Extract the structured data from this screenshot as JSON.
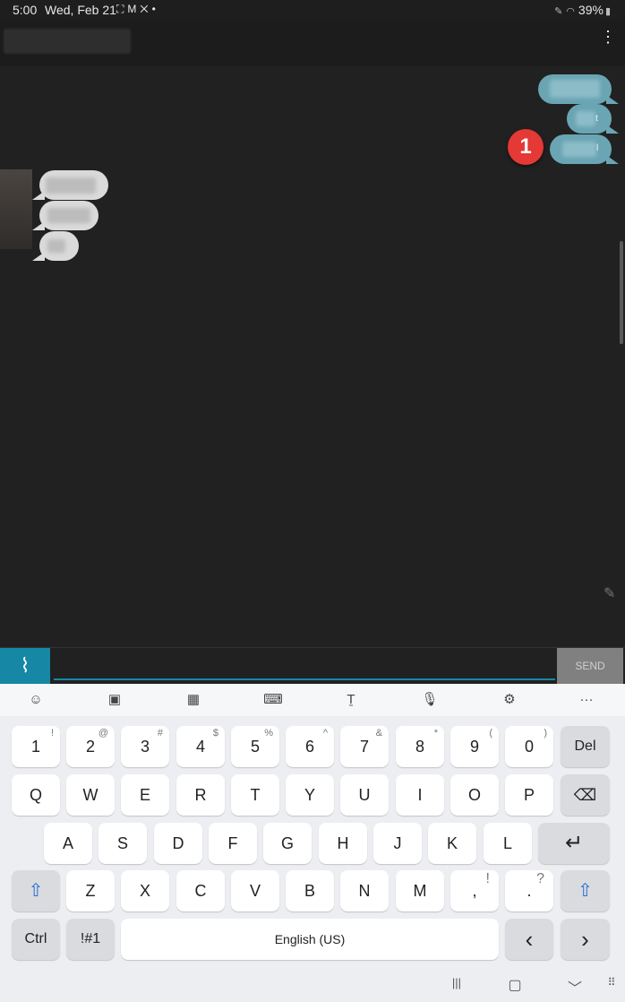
{
  "status_bar": {
    "time": "5:00",
    "date": "Wed, Feb 21",
    "icons": [
      "screenshot-icon",
      "gmail-icon",
      "tools-icon",
      "dot-icon"
    ],
    "battery": "39%",
    "right_icons": [
      "pen-icon",
      "wifi-icon",
      "battery-icon"
    ]
  },
  "toolbar": {
    "menu_glyph": "⋮"
  },
  "conversation": {
    "outgoing": [
      {
        "visible_char": ""
      },
      {
        "visible_char": "t"
      },
      {
        "visible_char": "l"
      }
    ],
    "badge_number": "1"
  },
  "compose": {
    "attach_glyph": "📎",
    "input_value": "",
    "input_placeholder": "",
    "send_label": "SEND"
  },
  "keyboard": {
    "toolbar": [
      "emoji-icon",
      "clipboard-icon",
      "one-handed-icon",
      "keyboard-icon",
      "handwriting-icon",
      "mic-icon",
      "settings-icon",
      "more-icon"
    ],
    "toolbar_glyphs": [
      "☺",
      "▣",
      "▦",
      "⌨",
      "Ṯ",
      "🎙",
      "⚙",
      "···"
    ],
    "row1": [
      {
        "label": "1",
        "sub": "!"
      },
      {
        "label": "2",
        "sub": "@"
      },
      {
        "label": "3",
        "sub": "#"
      },
      {
        "label": "4",
        "sub": "$"
      },
      {
        "label": "5",
        "sub": "%"
      },
      {
        "label": "6",
        "sub": "^"
      },
      {
        "label": "7",
        "sub": "&"
      },
      {
        "label": "8",
        "sub": "*"
      },
      {
        "label": "9",
        "sub": "("
      },
      {
        "label": "0",
        "sub": ")"
      }
    ],
    "del_label": "Del",
    "row2": [
      "Q",
      "W",
      "E",
      "R",
      "T",
      "Y",
      "U",
      "I",
      "O",
      "P"
    ],
    "backspace_glyph": "⌫",
    "row3": [
      "A",
      "S",
      "D",
      "F",
      "G",
      "H",
      "J",
      "K",
      "L"
    ],
    "enter_glyph": "↵",
    "row4": [
      "Z",
      "X",
      "C",
      "V",
      "B",
      "N",
      "M"
    ],
    "comma": {
      "label": ",",
      "sub": "!"
    },
    "period": {
      "label": ".",
      "sub": "?"
    },
    "shift_glyph": "⇧",
    "ctrl_label": "Ctrl",
    "symbols_label": "!#1",
    "space_label": "English (US)",
    "left_arrow": "‹",
    "right_arrow": "›",
    "nav": {
      "recents": "|||",
      "home": "▢",
      "back": "﹀",
      "keyboard": "⠿"
    }
  }
}
